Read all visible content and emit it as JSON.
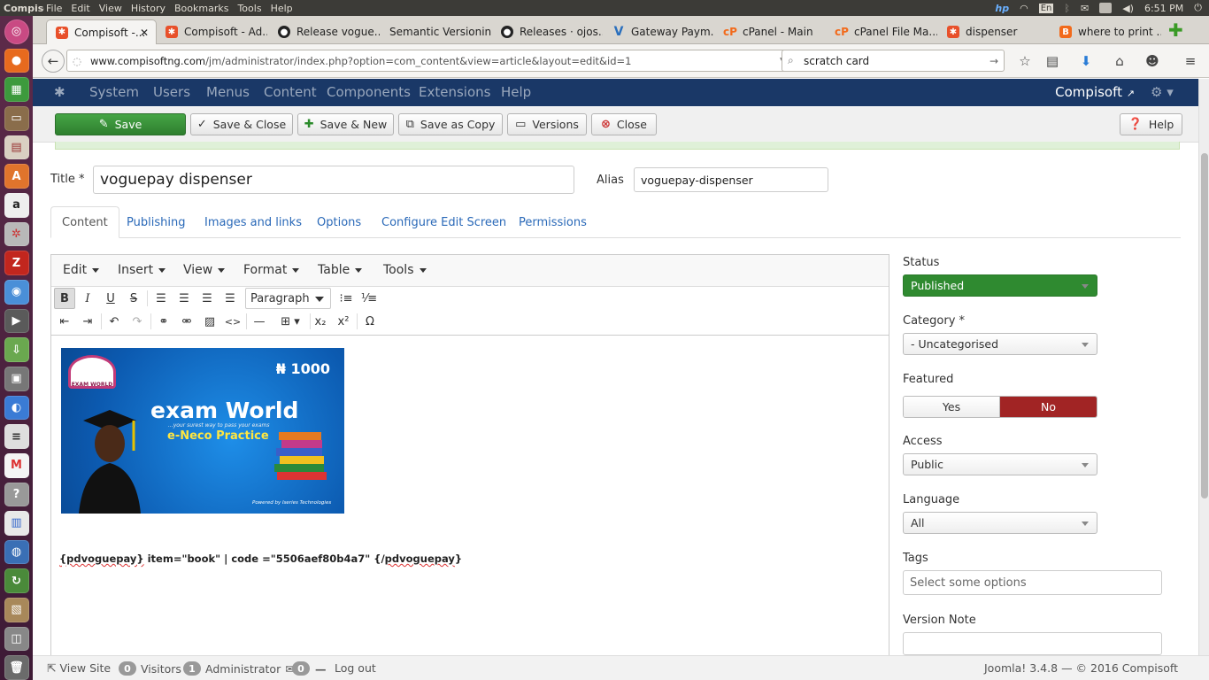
{
  "os_bar": {
    "app_name": "Compiso",
    "menus": [
      "File",
      "Edit",
      "View",
      "History",
      "Bookmarks",
      "Tools",
      "Help"
    ],
    "keyboard_layout": "En",
    "clock": "6:51 PM"
  },
  "launcher": [
    "ubuntu-icon",
    "firefox-icon",
    "libreoffice-calc-icon",
    "files-icon",
    "document-viewer-icon",
    "software-center-icon",
    "amazon-icon",
    "settings-icon",
    "filezilla-icon",
    "chromium-icon",
    "video-icon",
    "downloads-icon",
    "printer-icon",
    "browser-icon",
    "text-editor-icon",
    "gmail-icon",
    "help-icon",
    "document-icon",
    "network-icon",
    "update-icon",
    "archive-icon",
    "screenshot-icon",
    "trash-icon"
  ],
  "browser_tabs": [
    {
      "title": "Compisoft -...",
      "active": true,
      "color": "#e8502a"
    },
    {
      "title": "Compisoft - Ad...",
      "active": false,
      "color": "#e8502a"
    },
    {
      "title": "Release vogue...",
      "active": false,
      "color": "#222222"
    },
    {
      "title": "Semantic Versionin...",
      "active": false,
      "color": ""
    },
    {
      "title": "Releases · ojos...",
      "active": false,
      "color": "#222222"
    },
    {
      "title": "Gateway Paym...",
      "active": false,
      "color": "#2a6fbd"
    },
    {
      "title": "cPanel - Main",
      "active": false,
      "color": "#f26a1b"
    },
    {
      "title": "cPanel File Ma...",
      "active": false,
      "color": "#f26a1b"
    },
    {
      "title": "dispenser",
      "active": false,
      "color": "#e8502a"
    },
    {
      "title": "where to print ...",
      "active": false,
      "color": "#f26a1b"
    }
  ],
  "address_bar": {
    "domain": "www.compisoftng.com",
    "path": "/jm/administrator/index.php?option=com_content&view=article&layout=edit&id=1"
  },
  "search_bar": {
    "value": "scratch card"
  },
  "joomla_nav": {
    "items": [
      "System",
      "Users",
      "Menus",
      "Content",
      "Components",
      "Extensions",
      "Help"
    ],
    "site_name": "Compisoft"
  },
  "toolbar": {
    "save": "Save",
    "save_close": "Save & Close",
    "save_new": "Save & New",
    "save_copy": "Save as Copy",
    "versions": "Versions",
    "close": "Close",
    "help": "Help"
  },
  "article": {
    "title_label": "Title *",
    "title_value": "voguepay dispenser",
    "alias_label": "Alias",
    "alias_value": "voguepay-dispenser"
  },
  "edit_tabs": [
    "Content",
    "Publishing",
    "Images and links",
    "Options",
    "Configure Edit Screen",
    "Permissions"
  ],
  "editor": {
    "menus": [
      "Edit",
      "Insert",
      "View",
      "Format",
      "Table",
      "Tools"
    ],
    "block_format": "Paragraph",
    "content_code": "{pdvoguepay} item=\"book\" | code =\"5506aef80b4a7\" {/pdvoguepay}",
    "code_open": "{pdvoguepay}",
    "code_middle": " item=\"book\" | code =\"5506aef80b4a7\" {/",
    "code_close_word": "pdvoguepay",
    "code_end": "}",
    "image": {
      "price": "₦ 1000",
      "headline": "exam World",
      "tagline": "...your surest way to pass your exams",
      "subheadline": "e-Neco Practice",
      "logo_text": "EXAM WORLD",
      "credit": "Powered by Iseries Technologies"
    }
  },
  "sidebar": {
    "status_label": "Status",
    "status_value": "Published",
    "status_color": "#2f8a30",
    "category_label": "Category *",
    "category_value": "- Uncategorised",
    "featured_label": "Featured",
    "featured_yes": "Yes",
    "featured_no": "No",
    "featured_selected": "No",
    "featured_no_color": "#a12424",
    "access_label": "Access",
    "access_value": "Public",
    "language_label": "Language",
    "language_value": "All",
    "tags_label": "Tags",
    "tags_placeholder": "Select some options",
    "version_note_label": "Version Note",
    "version_note_value": ""
  },
  "footer": {
    "view_site": "View Site",
    "visitors_count": "0",
    "visitors_label": "Visitors",
    "admin_count": "1",
    "admin_label": "Administrator",
    "messages_count": "0",
    "logout": "Log out",
    "version": "Joomla! 3.4.8",
    "copyright": "— © 2016 Compisoft"
  }
}
